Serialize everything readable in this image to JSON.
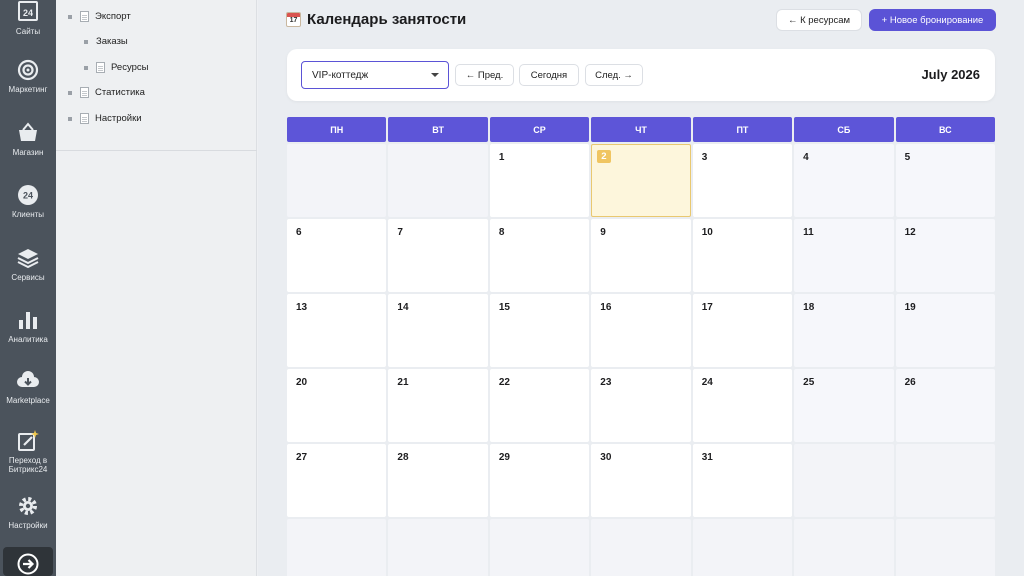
{
  "rail": [
    {
      "label": "Сайты",
      "icon": "sites-icon"
    },
    {
      "label": "Маркетинг",
      "icon": "target-icon"
    },
    {
      "label": "Магазин",
      "icon": "basket-icon"
    },
    {
      "label": "Клиенты",
      "icon": "clients-24-icon"
    },
    {
      "label": "Сервисы",
      "icon": "layers-icon"
    },
    {
      "label": "Аналитика",
      "icon": "bar-chart-icon"
    },
    {
      "label": "Marketplace",
      "icon": "cloud-download-icon"
    },
    {
      "label": "Переход в Битрикс24",
      "icon": "edit-star-icon"
    },
    {
      "label": "Настройки",
      "icon": "gear-icon"
    },
    {
      "label": "",
      "icon": "logout-arrow-icon"
    }
  ],
  "tree": {
    "items": [
      {
        "label": "Экспорт"
      },
      {
        "label": "Заказы"
      },
      {
        "label": "Ресурсы"
      },
      {
        "label": "Статистика"
      },
      {
        "label": "Настройки"
      }
    ]
  },
  "header": {
    "title": "Календарь занятости",
    "icon_day": "17",
    "back_label": "← К ресурсам",
    "new_label": "+ Новое бронирование"
  },
  "toolbar": {
    "resource": "VIP-коттедж",
    "prev_label": "← Пред.",
    "today_label": "Сегодня",
    "next_label": "След. →",
    "month_label": "July 2026"
  },
  "weekdays": [
    "ПН",
    "ВТ",
    "СР",
    "ЧТ",
    "ПТ",
    "СБ",
    "ВС"
  ],
  "calendar": {
    "leading_blank": 2,
    "days_in_month": 31,
    "today": 2,
    "colors": {
      "accent": "#5b53d6",
      "today_bg": "#fdf6dc",
      "today_badge": "#f0c561"
    }
  }
}
